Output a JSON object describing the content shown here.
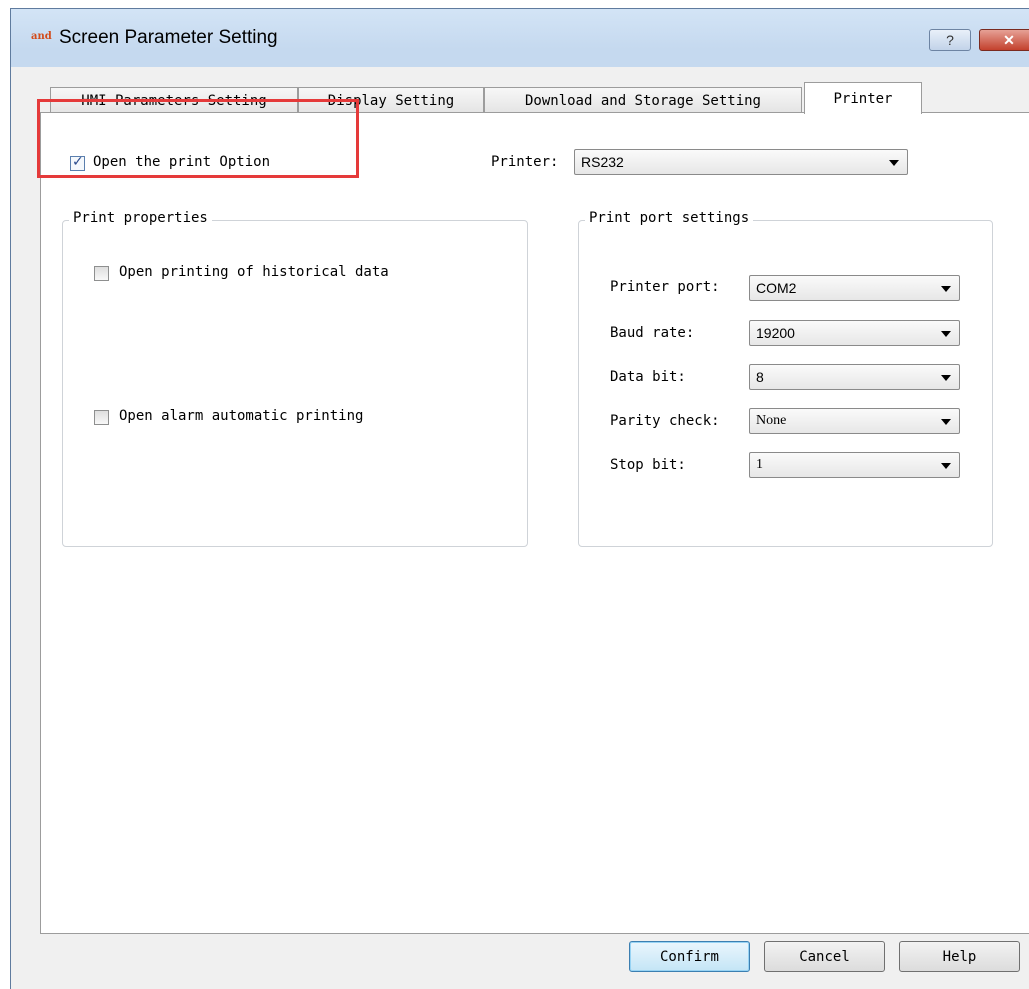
{
  "window": {
    "title": "Screen Parameter Setting",
    "app_icon_text": "and",
    "help_button": "?",
    "close_button": "✕"
  },
  "tabs": [
    {
      "label": "HMI Parameters Setting",
      "active": false
    },
    {
      "label": "Display Setting",
      "active": false
    },
    {
      "label": "Download and Storage Setting",
      "active": false
    },
    {
      "label": "Printer",
      "active": true
    }
  ],
  "printer_tab": {
    "open_print_option": {
      "label": "Open the print Option",
      "checked": true
    },
    "printer_label": "Printer:",
    "printer_value": "RS232",
    "print_properties": {
      "title": "Print properties",
      "historical": {
        "label": "Open printing of historical data",
        "checked": false
      },
      "alarm": {
        "label": "Open alarm automatic printing",
        "checked": false
      }
    },
    "port_settings": {
      "title": "Print port settings",
      "fields": [
        {
          "label": "Printer port:",
          "value": "COM2"
        },
        {
          "label": "Baud rate:",
          "value": "19200"
        },
        {
          "label": "Data bit:",
          "value": "8"
        },
        {
          "label": "Parity check:",
          "value": "None"
        },
        {
          "label": "Stop bit:",
          "value": "1"
        }
      ]
    }
  },
  "buttons": {
    "confirm": "Confirm",
    "cancel": "Cancel",
    "help": "Help"
  },
  "colors": {
    "highlight": "#e53a3a",
    "title_bar": "#c5d9ef"
  }
}
